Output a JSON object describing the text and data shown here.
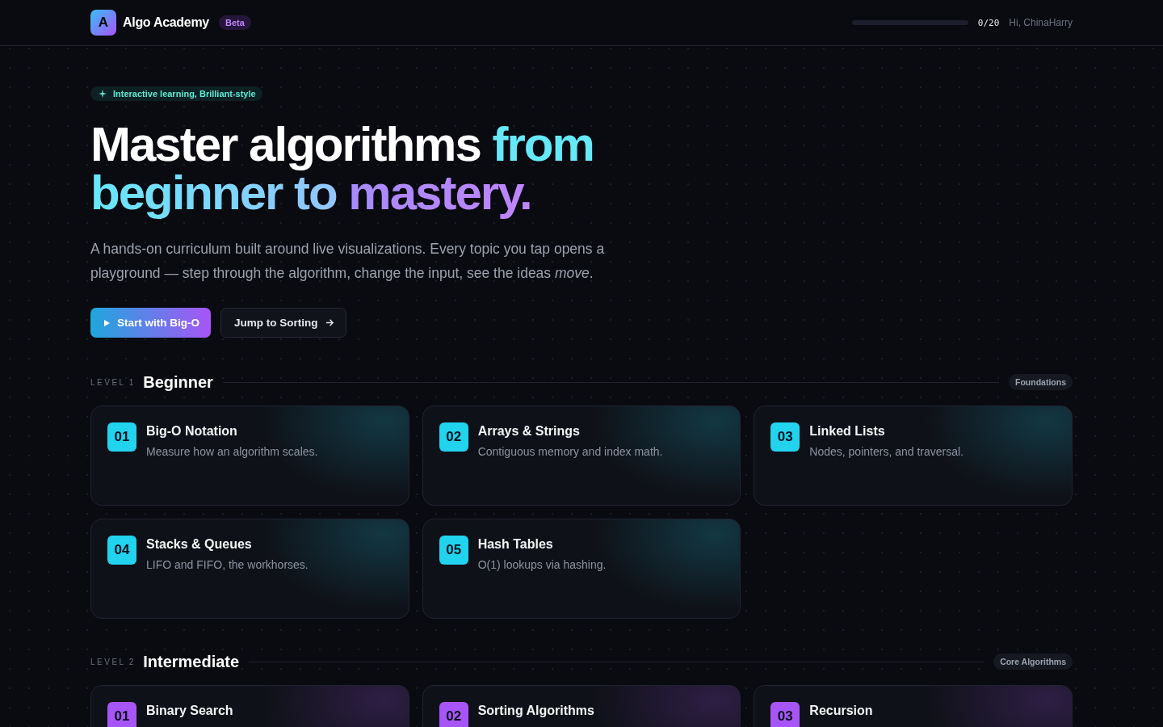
{
  "header": {
    "logo_letter": "A",
    "brand": "Algo Academy",
    "badge": "Beta",
    "progress": {
      "level": 0,
      "reading": "0/20"
    },
    "greeting": "Hi, ChinaHarry"
  },
  "hero": {
    "tag": "Interactive learning, Brilliant-style",
    "title_plain": "Master algorithms",
    "title_accent_1": "from",
    "title_accent_2": "beginner to",
    "title_accent_3": "mastery.",
    "lead": "A hands-on curriculum built around live visualizations. Every topic you tap opens a playground — step through the algorithm, change the input, see the ideas *move*.",
    "buttons": [
      {
        "label": "Start with Big-O",
        "kind": "primary"
      },
      {
        "label": "Jump to Sorting",
        "kind": "secondary"
      }
    ]
  },
  "levels": [
    {
      "label": "LEVEL",
      "number": "1",
      "title": "Beginner",
      "tag": "Foundations",
      "color": "#22d3ee",
      "topics": [
        {
          "number": "01",
          "title": "Big-O Notation",
          "description": "Measure how an algorithm scales."
        },
        {
          "number": "02",
          "title": "Arrays & Strings",
          "description": "Contiguous memory and index math."
        },
        {
          "number": "03",
          "title": "Linked Lists",
          "description": "Nodes, pointers, and traversal."
        },
        {
          "number": "04",
          "title": "Stacks & Queues",
          "description": "LIFO and FIFO, the workhorses."
        },
        {
          "number": "05",
          "title": "Hash Tables",
          "description": "O(1) lookups via hashing."
        }
      ]
    },
    {
      "label": "LEVEL",
      "number": "2",
      "title": "Intermediate",
      "tag": "Core Algorithms",
      "color": "#a855f7",
      "topics": [
        {
          "number": "01",
          "title": "Binary Search"
        },
        {
          "number": "02",
          "title": "Sorting Algorithms"
        },
        {
          "number": "03",
          "title": "Recursion"
        }
      ]
    }
  ]
}
